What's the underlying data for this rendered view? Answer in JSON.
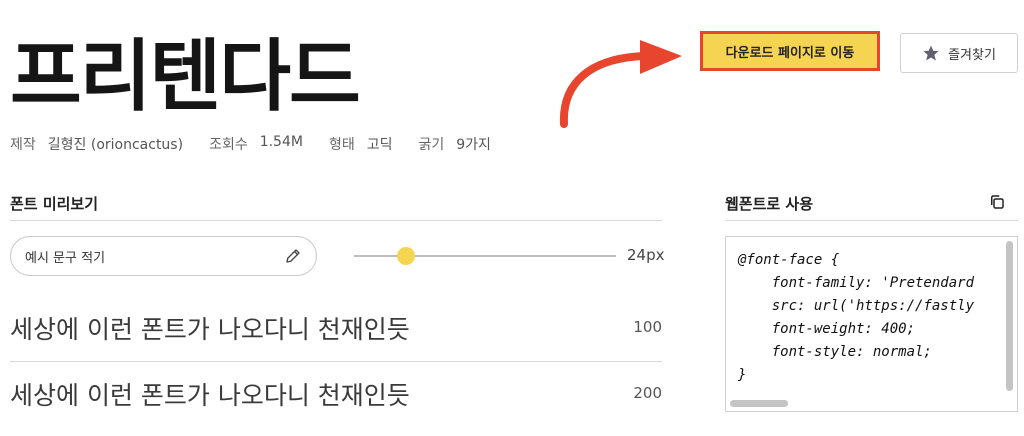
{
  "font": {
    "name": "프리텐다드",
    "meta": [
      {
        "key": "제작",
        "value": "길형진 (orioncactus)"
      },
      {
        "key": "조회수",
        "value": "1.54M"
      },
      {
        "key": "형태",
        "value": "고딕"
      },
      {
        "key": "굵기",
        "value": "9가지"
      }
    ]
  },
  "actions": {
    "download_label": "다운로드 페이지로 이동",
    "favorite_label": "즐겨찾기",
    "favorite_icon": "star-icon",
    "highlight_color": "#e8452f"
  },
  "preview": {
    "section_title": "폰트 미리보기",
    "input_placeholder": "예시 문구 적기",
    "edit_icon": "pencil-icon",
    "size_value": 24,
    "size_label": "24px",
    "rows": [
      {
        "text": "세상에 이런 폰트가 나오다니 천재인듯",
        "weight": "100"
      },
      {
        "text": "세상에 이런 폰트가 나오다니 천재인듯",
        "weight": "200"
      }
    ]
  },
  "webfont": {
    "section_title": "웹폰트로 사용",
    "copy_icon": "copy-icon",
    "code_lines": [
      "@font-face {",
      "    font-family: 'Pretendard",
      "    src: url('https://fastly",
      "    font-weight: 400;",
      "    font-style: normal;",
      "}"
    ]
  },
  "colors": {
    "accent_yellow": "#f5d451",
    "accent_red": "#e8452f"
  }
}
